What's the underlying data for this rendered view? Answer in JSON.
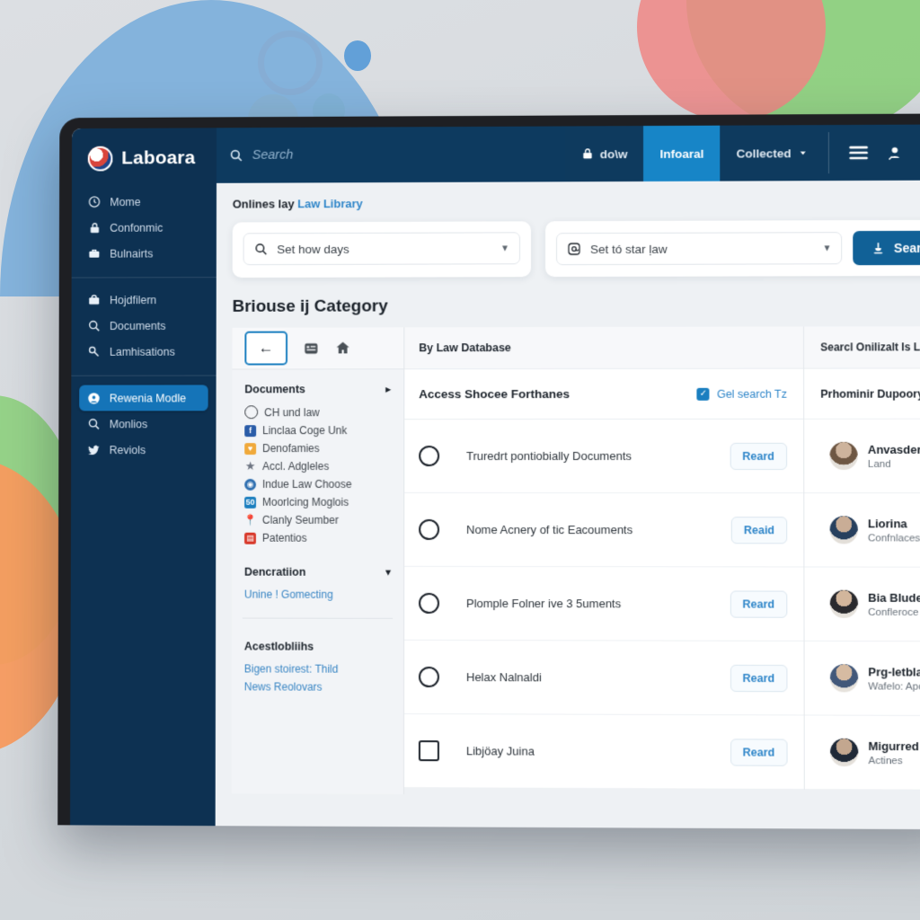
{
  "brand": {
    "name": "Laboara",
    "logo_icon": "eagle-emblem-icon"
  },
  "sidebar": {
    "group1": [
      {
        "label": "Mome",
        "icon": "clock-icon"
      },
      {
        "label": "Confonmic",
        "icon": "lock-icon"
      },
      {
        "label": "Bulnairts",
        "icon": "briefcase-icon"
      }
    ],
    "group2": [
      {
        "label": "Hojdfilern",
        "icon": "bag-icon"
      },
      {
        "label": "Documents",
        "icon": "search-icon"
      },
      {
        "label": "Lamhisations",
        "icon": "key-icon"
      }
    ],
    "group3": [
      {
        "label": "Rewenia Modle",
        "icon": "user-circle-icon",
        "active": true
      },
      {
        "label": "Monlios",
        "icon": "search-icon",
        "active": false
      },
      {
        "label": "Reviols",
        "icon": "twitter-bird-icon",
        "active": false
      }
    ]
  },
  "topbar": {
    "search_placeholder": "Search",
    "search_icon": "search-icon",
    "items": [
      {
        "label": "do\\w",
        "icon": "lock-icon",
        "selected": false
      },
      {
        "label": "Infoaral",
        "icon": "",
        "selected": true
      },
      {
        "label": "Collected",
        "icon": "chevron-down-icon",
        "selected": false
      }
    ],
    "icons": [
      "hamburger-menu-icon",
      "user-search-icon",
      "avatar"
    ]
  },
  "breadcrumb": {
    "prefix": "Onlines lay",
    "link": "Law Library"
  },
  "filters": {
    "left": {
      "value": "Set how days",
      "icon": "search-icon",
      "caret": "chevron-down-icon"
    },
    "right": {
      "value": "Set tó star ḷaw",
      "icon": "at-circle-icon",
      "caret": "chevron-down-icon"
    },
    "search_button": {
      "label": "Search",
      "icon": "scale-icon"
    }
  },
  "section_title": "Briouse ij Category",
  "left_panel": {
    "toolbar": {
      "back_icon": "arrow-left-icon",
      "grid_icon": "grid-icon",
      "home_icon": "home-icon"
    },
    "documents": {
      "title": "Documents",
      "caret": "triangle-right-icon",
      "items": [
        {
          "label": "CH und law",
          "icon": "circle-outline-icon",
          "color": "#2f343a"
        },
        {
          "label": "Linclaa Coge Unk",
          "icon": "facebook-icon",
          "color": "#2a5ca8"
        },
        {
          "label": "Denofamies",
          "icon": "heart-icon",
          "color": "#f0a93b"
        },
        {
          "label": "Accl. Adgleles",
          "icon": "star-icon",
          "color": "#6b7280"
        },
        {
          "label": "Indue Law Choose",
          "icon": "globe-icon",
          "color": "#2f6fb0"
        },
        {
          "label": "Moorlcing Moglois",
          "icon": "badge-icon",
          "color": "#1c7fbf"
        },
        {
          "label": "Clanly Seumber",
          "icon": "pin-icon",
          "color": "#c0392b"
        },
        {
          "label": "Patentios",
          "icon": "book-icon",
          "color": "#d83a2c"
        }
      ]
    },
    "description": {
      "title": "Dencratiion",
      "caret": "chevron-down-icon",
      "link": "Unine ! Gomecting"
    },
    "accessibility": {
      "title": "Acestlobliihs",
      "links": [
        "Bigen stoirest: Thild",
        "News Reolovars"
      ]
    }
  },
  "center_panel": {
    "header": "By Law Database",
    "subheader": "Access Shocee Forthanes",
    "select_all": {
      "label": "Gel search Tz",
      "icon": "checkbox-checked-icon"
    },
    "rows": [
      {
        "title": "Truredrt pontiobially Documents",
        "action": "Reard",
        "control": "radio"
      },
      {
        "title": "Nome Acnery of tic Eacouments",
        "action": "Reaid",
        "control": "radio"
      },
      {
        "title": "Plomple Folner ive 3 5uments",
        "action": "Reard",
        "control": "radio"
      },
      {
        "title": "Helax Nalnaldi",
        "action": "Reard",
        "control": "radio"
      },
      {
        "title": "Libjӧay Juina",
        "action": "Reard",
        "control": "checkbox"
      }
    ]
  },
  "right_panel": {
    "header": "Searcl Onilizalt Is Law",
    "subheader": "Prhominir Dupoory",
    "people": [
      {
        "name": "Anvasder",
        "role": "Land"
      },
      {
        "name": "Liorina",
        "role": "Confnlaces"
      },
      {
        "name": "Bia Bludes",
        "role": "Confleroce"
      },
      {
        "name": "Prg-letblaris",
        "role": "Wafelo: Apolk"
      },
      {
        "name": "Migurred Poli",
        "role": "Actines"
      }
    ]
  },
  "colors": {
    "sidebar_bg": "#0d3152",
    "topbar_bg": "#0e3a5e",
    "accent": "#1785c7",
    "link": "#2f86c9",
    "button": "#116197"
  }
}
